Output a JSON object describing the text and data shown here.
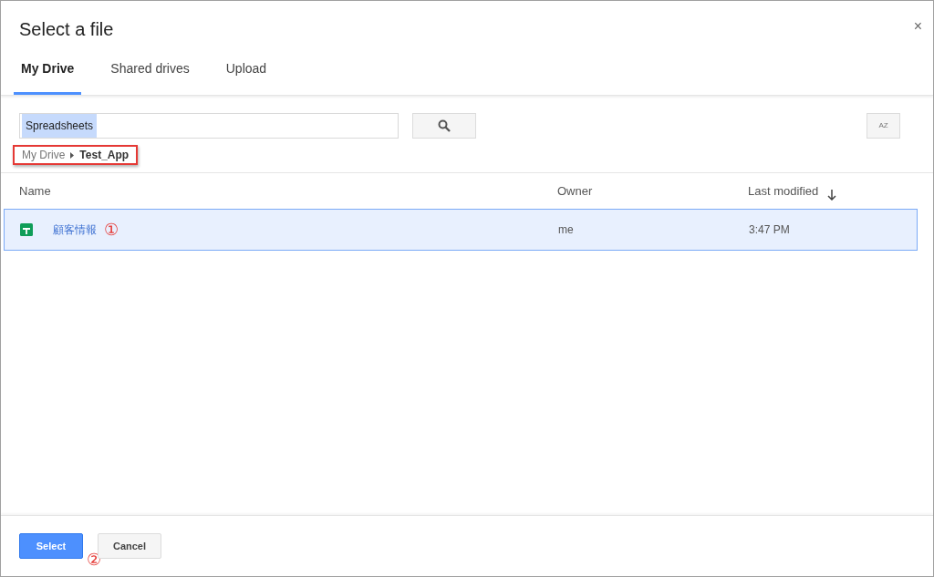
{
  "dialog": {
    "title": "Select a file",
    "close": "×"
  },
  "tabs": [
    {
      "label": "My Drive",
      "selected": true
    },
    {
      "label": "Shared drives",
      "selected": false
    },
    {
      "label": "Upload",
      "selected": false
    }
  ],
  "search": {
    "value": "Spreadsheets",
    "value_selected": true
  },
  "sort_button": {
    "label": "AZ"
  },
  "breadcrumb": {
    "items": [
      "My Drive",
      "Test_App"
    ],
    "highlighted": true
  },
  "table": {
    "columns": [
      {
        "label": "Name",
        "sorted": false
      },
      {
        "label": "Owner",
        "sorted": false
      },
      {
        "label": "Last modified",
        "sorted": true
      }
    ],
    "rows": [
      {
        "name": "顧客情報",
        "owner": "me",
        "modified": "3:47 PM",
        "selected": true,
        "annotation": "①"
      }
    ]
  },
  "buttons": [
    {
      "label": "Select",
      "kind": "primary",
      "annotation": "②"
    },
    {
      "label": "Cancel",
      "kind": "secondary"
    }
  ]
}
